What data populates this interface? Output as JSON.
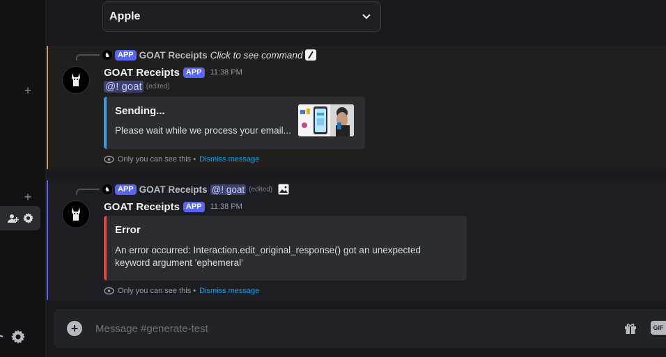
{
  "sidebar": {
    "plus_1": "+",
    "plus_2": "+"
  },
  "select": {
    "value": "Apple"
  },
  "message1": {
    "reply": {
      "app_tag": "APP",
      "name": "GOAT Receipts",
      "command_text": "Click to see command"
    },
    "author": "GOAT Receipts",
    "app_tag": "APP",
    "timestamp": "11:38 PM",
    "mention": "@! goat",
    "edited": "(edited)",
    "embed": {
      "title": "Sending...",
      "description": "Please wait while we process your email..."
    },
    "ephemeral_text": "Only you can see this •",
    "dismiss": "Dismiss message"
  },
  "message2": {
    "reply": {
      "app_tag": "APP",
      "name": "GOAT Receipts",
      "mention": "@! goat",
      "edited": "(edited)"
    },
    "author": "GOAT Receipts",
    "app_tag": "APP",
    "timestamp": "11:38 PM",
    "embed": {
      "title": "Error",
      "description_line1": "An error occurred: Interaction.edit_original_response() got an unexpected",
      "description_line2": "keyword argument 'ephemeral'"
    },
    "ephemeral_text": "Only you can see this •",
    "dismiss": "Dismiss message"
  },
  "composer": {
    "placeholder": "Message #generate-test",
    "gif_label": "GIF"
  },
  "colors": {
    "blurple": "#5865f2",
    "embed_blue": "#3b9ae1",
    "embed_red": "#e2433d",
    "highlight_gold": "#c8a25b",
    "link": "#00a8fc"
  },
  "icons": [
    "plus-icon",
    "add-member-icon",
    "gear-icon",
    "chevron-down-icon",
    "slash-command-icon",
    "image-icon",
    "eye-icon",
    "add-circle-icon",
    "gift-icon",
    "gif-icon",
    "headset-icon"
  ]
}
